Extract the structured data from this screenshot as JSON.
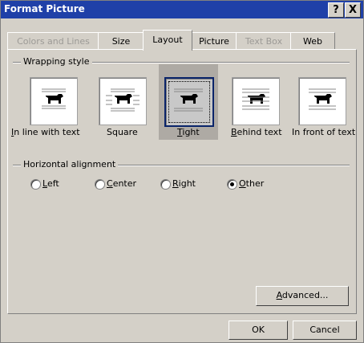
{
  "window": {
    "title": "Format Picture"
  },
  "title_buttons": {
    "help": "?",
    "close": "X"
  },
  "tabs": [
    {
      "label": "Colors and Lines",
      "state": "disabled"
    },
    {
      "label": "Size",
      "state": "normal"
    },
    {
      "label": "Layout",
      "state": "active"
    },
    {
      "label": "Picture",
      "state": "normal"
    },
    {
      "label": "Text Box",
      "state": "disabled"
    },
    {
      "label": "Web",
      "state": "normal"
    }
  ],
  "wrapping": {
    "group_label": "Wrapping style",
    "options": [
      {
        "label": "In line with text",
        "icon": "inline-wrap-icon",
        "mnemonic": "I",
        "rest": "n line with text"
      },
      {
        "label": "Square",
        "icon": "square-wrap-icon",
        "mnemonic": "",
        "rest": "Square"
      },
      {
        "label": "Tight",
        "icon": "tight-wrap-icon",
        "mnemonic": "T",
        "rest": "ight",
        "selected": true
      },
      {
        "label": "Behind text",
        "icon": "behind-text-wrap-icon",
        "mnemonic": "B",
        "rest": "ehind text"
      },
      {
        "label": "In front of text",
        "icon": "in-front-of-text-wrap-icon",
        "mnemonic": "",
        "rest": "In front of text"
      }
    ]
  },
  "alignment": {
    "group_label": "Horizontal alignment",
    "options": [
      {
        "label": "Left",
        "m": "L",
        "rest": "eft",
        "checked": false
      },
      {
        "label": "Center",
        "m": "C",
        "rest": "enter",
        "checked": false
      },
      {
        "label": "Right",
        "m": "R",
        "rest": "ight",
        "checked": false
      },
      {
        "label": "Other",
        "m": "O",
        "rest": "ther",
        "checked": true
      }
    ]
  },
  "buttons": {
    "advanced_m": "A",
    "advanced_rest": "dvanced...",
    "ok": "OK",
    "cancel": "Cancel"
  },
  "colors": {
    "titlebar": "#1f40a8",
    "face": "#d4d0c8",
    "disabled_text": "#9c9a96",
    "selection": "#0a246a"
  }
}
